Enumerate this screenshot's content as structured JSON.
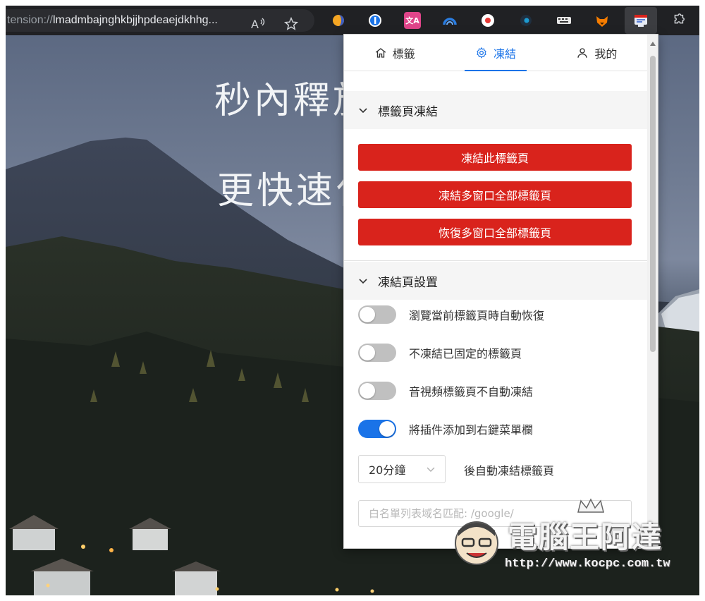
{
  "browser": {
    "url_scheme": "tension://",
    "url_rest": "lmadmbajnghkbjjhpdeaejdkhhg...",
    "read_aloud_icon": "read-aloud-icon",
    "favorite_icon": "star-icon",
    "extensions": [
      {
        "name": "ext-orange-icon",
        "color": "#f5a623"
      },
      {
        "name": "ext-1password-icon",
        "color": "#1a73e8"
      },
      {
        "name": "ext-translate-icon",
        "color": "#e0458a"
      },
      {
        "name": "ext-arc-icon",
        "color": "#2a7de1"
      },
      {
        "name": "ext-record-icon",
        "color": "#e53935"
      },
      {
        "name": "ext-dark-icon",
        "color": "#1d9bd1"
      },
      {
        "name": "ext-keyboard-icon",
        "color": "#dddddd"
      },
      {
        "name": "ext-fox-icon",
        "color": "#f57c00"
      },
      {
        "name": "ext-freeze-tab-icon",
        "color": "#5b7fd6"
      }
    ]
  },
  "hero": {
    "line1": "秒內釋放",
    "line2": "更快速化"
  },
  "popup": {
    "tabs": [
      {
        "label": "標籤",
        "icon": "home-icon"
      },
      {
        "label": "凍結",
        "icon": "gear-icon"
      },
      {
        "label": "我的",
        "icon": "user-icon"
      }
    ],
    "active_tab": 1,
    "section_freeze": {
      "title": "標籤頁凍結",
      "buttons": [
        "凍結此標籤頁",
        "凍結多窗口全部標籤頁",
        "恢復多窗口全部標籤頁"
      ]
    },
    "section_settings": {
      "title": "凍結頁設置",
      "toggles": [
        {
          "label": "瀏覽當前標籤頁時自動恢復",
          "on": false
        },
        {
          "label": "不凍結已固定的標籤頁",
          "on": false
        },
        {
          "label": "音視頻標籤頁不自動凍結",
          "on": false
        },
        {
          "label": "將插件添加到右鍵菜單欄",
          "on": true
        }
      ],
      "delay_value": "20分鐘",
      "delay_suffix": "後自動凍結標籤頁",
      "whitelist_placeholder": "白名單列表域名匹配: /google/"
    },
    "accent_color": "#1a73e8",
    "button_color": "#d9231c"
  },
  "watermark": {
    "text": "電腦王阿達",
    "url": "http://www.kocpc.com.tw"
  }
}
